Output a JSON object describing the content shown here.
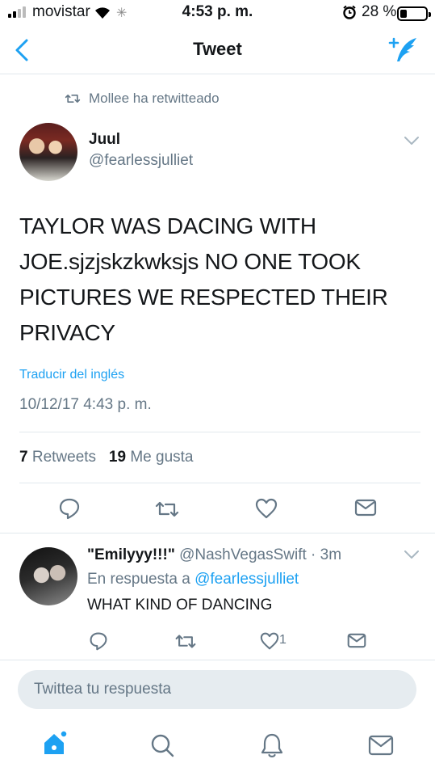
{
  "status_bar": {
    "carrier": "movistar",
    "time": "4:53 p. m.",
    "battery": "28 %",
    "battery_level": 0.28
  },
  "nav": {
    "title": "Tweet",
    "back_icon": "chevron-left-icon",
    "compose_icon": "compose-tweet-icon"
  },
  "tweet": {
    "retweeted_by": "Mollee ha retwitteado",
    "author_name": "Juul",
    "author_handle": "@fearlessjulliet",
    "text_lines": [
      "TAYLOR WAS DACING WITH",
      "JOE.sjzjskzkwksjs NO ONE TOOK",
      "PICTURES WE RESPECTED THEIR",
      "PRIVACY"
    ],
    "translate_label": "Traducir del inglés",
    "timestamp": "10/12/17 4:43 p. m.",
    "retweet_count": "7",
    "retweet_label": "Retweets",
    "like_count": "19",
    "like_label": "Me gusta"
  },
  "reply": {
    "author_name": "\"Emilyyy!!!\"",
    "author_handle": "@NashVegasSwift",
    "time": "· 3m",
    "reply_prefix": "En respuesta a",
    "reply_to": "@fearlessjulliet",
    "text": "WHAT KIND OF DANCING",
    "like_count": "1"
  },
  "compose": {
    "placeholder": "Twittea tu respuesta"
  },
  "tabbar": {
    "items": [
      "home-icon",
      "search-icon",
      "notifications-icon",
      "messages-icon"
    ]
  },
  "colors": {
    "accent": "#1da1f2",
    "muted": "#657786",
    "divider": "#e1e8ed",
    "icon": "#657786"
  }
}
